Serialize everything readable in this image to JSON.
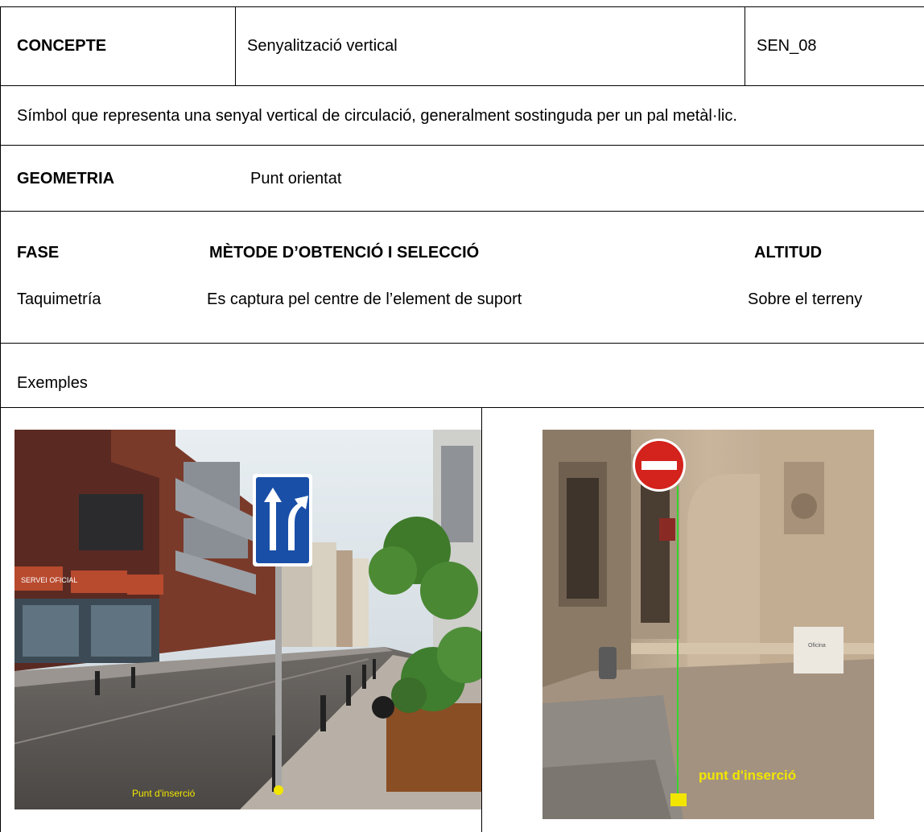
{
  "header": {
    "concept_label": "CONCEPTE",
    "concept_value": "Senyalització vertical",
    "code": "SEN_08"
  },
  "description": "Símbol que representa una senyal vertical de circulació, generalment sostinguda per un pal metàl·lic.",
  "geometry": {
    "label": "GEOMETRIA",
    "value": "Punt orientat"
  },
  "details": {
    "phase_label": "FASE",
    "method_label": "MÈTODE D’OBTENCIÓ I SELECCIÓ",
    "altitude_label": "ALTITUD",
    "phase_value": "Taquimetría",
    "method_value": "Es captura pel centre de l’element de suport",
    "altitude_value": "Sobre el terreny"
  },
  "examples": {
    "label": "Exemples",
    "photo1_caption": "Punt d'inserció",
    "photo2_caption": "punt d'inserció",
    "photo1_shop_sign": "SERVEI OFICIAL",
    "photo2_plaque": "Oficina"
  },
  "colors": {
    "sign_blue": "#1a4fa8",
    "marker_yellow": "#f2e600",
    "guide_green": "#37d62b"
  }
}
